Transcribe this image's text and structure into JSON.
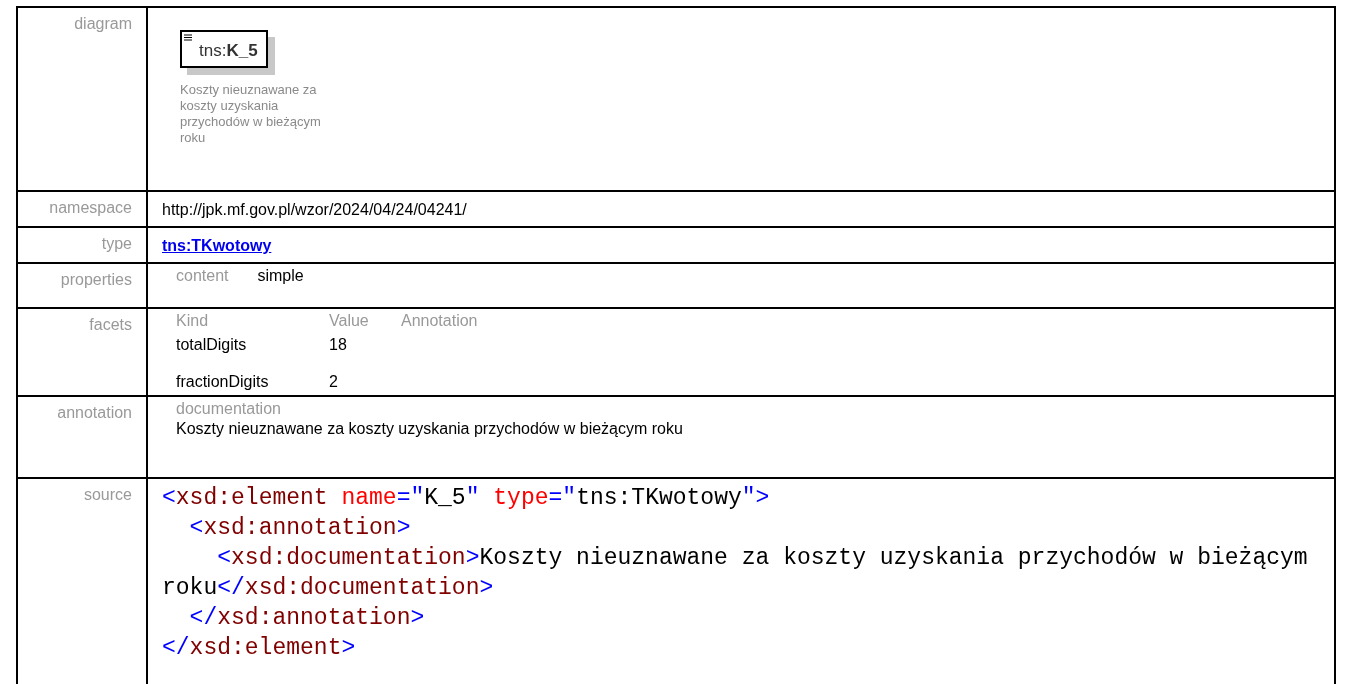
{
  "diagram": {
    "label": "diagram",
    "element": "tns:**K_5**",
    "description": "Koszty nieuznawane za koszty uzyskania przychodów w bieżącym roku"
  },
  "namespace": {
    "label": "namespace",
    "value": "http://jpk.mf.gov.pl/wzor/2024/04/24/04241/"
  },
  "type": {
    "label": "type",
    "value": "tns:TKwotowy"
  },
  "properties": {
    "label": "properties",
    "items": [
      {
        "name": "content",
        "value": "simple"
      }
    ]
  },
  "facets": {
    "label": "facets",
    "columns": [
      "Kind",
      "Value",
      "Annotation"
    ],
    "rows": [
      {
        "kind": "totalDigits",
        "value": "18"
      },
      {
        "kind": "fractionDigits",
        "value": "2"
      }
    ]
  },
  "annotation": {
    "label": "annotation",
    "heading": "documentation",
    "text": "Koszty nieuznawane za koszty uzyskania przychodów w bieżącym roku"
  },
  "source": {
    "label": "source",
    "lines": [
      [
        {
          "kind": "punct",
          "text": "<"
        },
        {
          "kind": "tag",
          "text": "xsd:element"
        },
        {
          "kind": "attr",
          "text": " name"
        },
        {
          "kind": "punct",
          "text": "=\""
        },
        {
          "kind": "text",
          "text": "K_5"
        },
        {
          "kind": "punct",
          "text": "\""
        },
        {
          "kind": "attr",
          "text": " type"
        },
        {
          "kind": "punct",
          "text": "=\""
        },
        {
          "kind": "text",
          "text": "tns:TKwotowy"
        },
        {
          "kind": "punct",
          "text": "\">"
        }
      ],
      [
        {
          "kind": "punct",
          "text": "  <"
        },
        {
          "kind": "tag",
          "text": "xsd:annotation"
        },
        {
          "kind": "punct",
          "text": ">"
        }
      ],
      [
        {
          "kind": "punct",
          "text": "    <"
        },
        {
          "kind": "tag",
          "text": "xsd:documentation"
        },
        {
          "kind": "punct",
          "text": ">"
        },
        {
          "kind": "text",
          "text": "Koszty nieuznawane za koszty uzyskania przychodów w bieżącym roku"
        },
        {
          "kind": "punct",
          "text": "</"
        },
        {
          "kind": "tag",
          "text": "xsd:documentation"
        },
        {
          "kind": "punct",
          "text": ">"
        }
      ],
      [
        {
          "kind": "punct",
          "text": "  </"
        },
        {
          "kind": "tag",
          "text": "xsd:annotation"
        },
        {
          "kind": "punct",
          "text": ">"
        }
      ],
      [
        {
          "kind": "punct",
          "text": "</"
        },
        {
          "kind": "tag",
          "text": "xsd:element"
        },
        {
          "kind": "punct",
          "text": ">"
        }
      ]
    ]
  }
}
